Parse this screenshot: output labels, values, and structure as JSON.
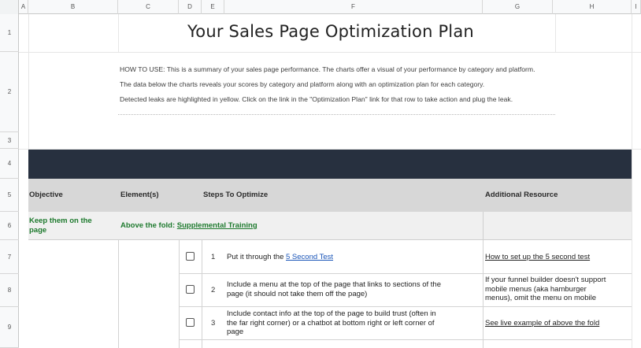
{
  "columns": [
    "A",
    "B",
    "C",
    "D",
    "E",
    "F",
    "G",
    "H",
    "I"
  ],
  "rows": [
    "1",
    "2",
    "3",
    "4",
    "5",
    "6",
    "7",
    "8",
    "9"
  ],
  "title": "Your Sales Page Optimization Plan",
  "howto": {
    "line1": "HOW TO USE: This is a summary of your sales page performance. The charts offer a visual of your performance by category and platform.",
    "line2": "The data below the charts reveals your scores by category and platform along with an optimization plan for each category.",
    "line3": "Detected leaks are highlighted in yellow. Click on the link in the \"Optimization Plan\" link for that row to take action and plug the leak."
  },
  "table": {
    "headers": {
      "objective": "Objective",
      "elements": "Element(s)",
      "steps": "Steps To Optimize",
      "resource": "Additional Resource"
    },
    "section": {
      "objective_line1": "Keep them on the",
      "objective_line2": "page",
      "element_prefix": "Above the fold: ",
      "element_link": "Supplemental Training"
    },
    "steps": [
      {
        "num": "1",
        "text_prefix": "Put it through the ",
        "text_link": "5 Second Test",
        "resource_link": "How to set up the 5 second test"
      },
      {
        "num": "2",
        "line1": "Include a menu at the top of the page that links to sections of the",
        "line2": "page (it should not take them off the page)",
        "res_line1": "If your funnel builder doesn't support",
        "res_line2": "mobile menus (aka hamburger",
        "res_line3": "menus), omit the menu on mobile"
      },
      {
        "num": "3",
        "line1": "Include contact info at the top of the page to build trust (often in",
        "line2": "the far right corner) or a chatbot at bottom right or left corner of",
        "line3": "page",
        "resource_link": "See live example of above the fold"
      }
    ]
  },
  "colors": {
    "dark_band": "#27303f",
    "header_gray": "#d7d7d7",
    "green_text": "#1e7a2e",
    "link_blue": "#1a55b8"
  }
}
